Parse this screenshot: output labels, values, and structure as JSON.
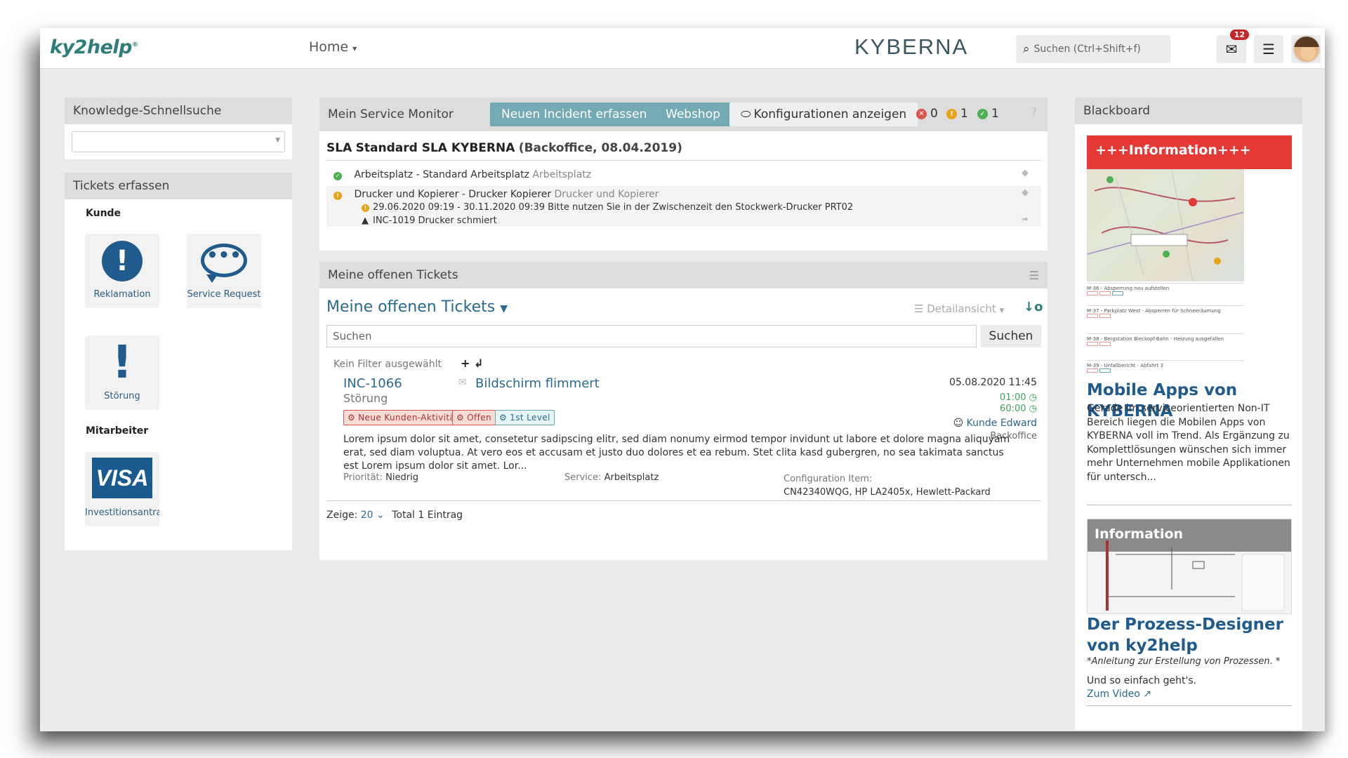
{
  "topbar": {
    "logo": "ky2help",
    "logo_reg": "®",
    "nav_home": "Home",
    "brand": "KYBERNA",
    "search_placeholder": "Suchen (Ctrl+Shift+f)",
    "mail_badge": "12"
  },
  "knowledge": {
    "title": "Knowledge-Schnellsuche"
  },
  "tickets_erfassen": {
    "title": "Tickets erfassen",
    "group_kunde": "Kunde",
    "group_mitarbeiter": "Mitarbeiter",
    "tiles": [
      {
        "label": "Reklamation",
        "icon": "exclamation-circle-icon"
      },
      {
        "label": "Service Request",
        "icon": "speech-bubble-icon"
      },
      {
        "label": "Störung",
        "icon": "exclamation-icon"
      },
      {
        "label": "Investitionsantrag",
        "icon": "visa-card-icon"
      }
    ],
    "visa_text": "VISA"
  },
  "service_monitor": {
    "title": "Mein Service Monitor",
    "btn_new_incident": "Neuen Incident erfassen",
    "btn_webshop": "Webshop",
    "btn_config": "Konfigurationen anzeigen",
    "stat_red": "0",
    "stat_orange": "1",
    "stat_green": "1",
    "help": "?",
    "sla_prefix": "SLA",
    "sla_name": "Standard SLA KYBERNA",
    "sla_suffix": "(Backoffice, 08.04.2019)",
    "rows": [
      {
        "status": "green",
        "title": "Arbeitsplatz - Standard Arbeitsplatz",
        "sub": "Arbeitsplatz"
      },
      {
        "status": "orange",
        "title": "Drucker und Kopierer - Drucker Kopierer",
        "sub": "Drucker und Kopierer",
        "notice": "29.06.2020 09:19 - 30.11.2020 09:39   Bitte nutzen Sie in der Zwischenzeit den Stockwerk-Drucker PRT02",
        "incident": "INC-1019 Drucker schmiert"
      }
    ]
  },
  "open_tickets": {
    "header": "Meine offenen Tickets",
    "title": "Meine offenen Tickets",
    "view": "Detailansicht",
    "search_placeholder": "Suchen",
    "search_btn": "Suchen",
    "filter": "Kein Filter ausgewählt",
    "ticket": {
      "id": "INC-1066",
      "type": "Störung",
      "name": "Bildschirm flimmert",
      "date": "05.08.2020 11:45",
      "time1": "01:00",
      "time2": "60:00",
      "tags": [
        "Neue Kunden-Aktivität",
        "Offen",
        "1st Level"
      ],
      "person": "Kunde Edward",
      "dept": "Backoffice",
      "description": "Lorem ipsum dolor sit amet, consetetur sadipscing elitr, sed diam nonumy eirmod tempor invidunt ut labore et dolore magna aliquyam erat, sed diam voluptua. At vero eos et accusam et justo duo dolores et ea rebum. Stet clita kasd gubergren, no sea takimata sanctus est Lorem ipsum dolor sit amet. Lor...",
      "priority_label": "Priorität:",
      "priority": "Niedrig",
      "service_label": "Service:",
      "service": "Arbeitsplatz",
      "ci_label": "Configuration Item:",
      "ci": "CN42340WQG, HP LA2405x, Hewlett-Packard"
    },
    "footer_show": "Zeige:",
    "footer_count": "20",
    "footer_total": "Total 1 Eintrag"
  },
  "blackboard": {
    "title": "Blackboard",
    "banner": "+++Information+++",
    "news_items": [
      "M-36 - Absperrung neu aufstellen",
      "M-37 - Parkplatz West - Absperren für Schneeräumung",
      "M-38 - Bergstation Bleckopf-Bahn - Heizung ausgefallen",
      "M-39 - Unfallbericht - Abfahrt 3"
    ],
    "article1_title": "Mobile Apps von KYBERNA",
    "article1_text": "Gerade im serviceorientierten Non-IT Bereich liegen die Mobilen Apps von KYBERNA voll im Trend. Als Ergänzung zu Komplettlösungen wünschen sich immer mehr Unternehmen mobile Applikationen für untersch...",
    "article2_head": "Information",
    "article2_title": "Der Prozess-Designer von ky2help",
    "article2_italic": "*Anleitung zur Erstellung von Prozessen. *",
    "article2_text": "Und so einfach geht's.",
    "article2_link": "Zum Video"
  }
}
